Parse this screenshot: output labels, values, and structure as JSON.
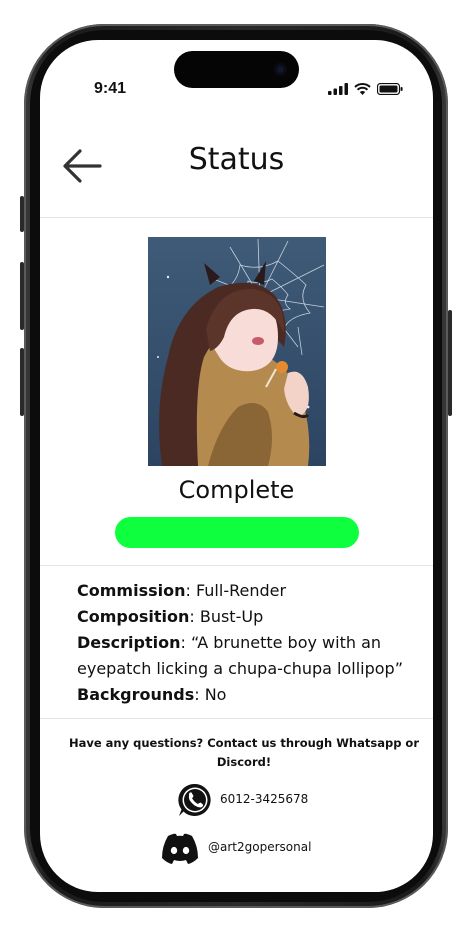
{
  "status_bar": {
    "time": "9:41"
  },
  "header": {
    "title": "Status",
    "back_icon": "arrow-left-icon"
  },
  "commission_status": {
    "label": "Complete",
    "progress": 1.0,
    "color": "#0dff3d"
  },
  "details": {
    "commission_label": "Commission",
    "commission_value": ": Full-Render",
    "composition_label": "Composition",
    "composition_value": ": Bust-Up",
    "description_label": "Description",
    "description_value": ": “A brunette boy with an eyepatch licking a chupa-chupa lollipop”",
    "backgrounds_label": "Backgrounds",
    "backgrounds_value": ": No"
  },
  "contact": {
    "prompt": "Have any questions? Contact us through Whatsapp or Discord!",
    "whatsapp_icon": "whatsapp-icon",
    "whatsapp_number": "6012-3425678",
    "discord_icon": "discord-icon",
    "discord_handle": "@art2gopersonal"
  }
}
